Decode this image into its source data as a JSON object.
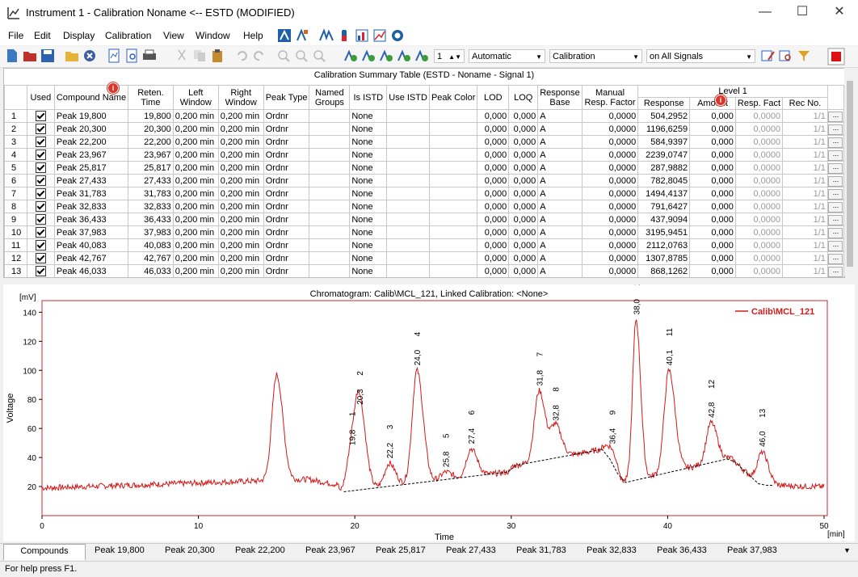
{
  "window": {
    "title": "Instrument 1 - Calibration Noname <-- ESTD (MODIFIED)"
  },
  "menu": [
    "File",
    "Edit",
    "Display",
    "Calibration",
    "View",
    "Window",
    "Help"
  ],
  "toolbar": {
    "page_value": "1",
    "combo_mode": "Automatic",
    "combo_view": "Calibration",
    "combo_signals": "on All Signals"
  },
  "table": {
    "caption": "Calibration Summary Table (ESTD - Noname - Signal 1)",
    "headers": {
      "used": "Used",
      "compound": "Compound Name",
      "reten": "Reten. Time",
      "left": "Left Window",
      "right": "Right Window",
      "peaktype": "Peak Type",
      "named": "Named Groups",
      "isistd": "Is ISTD",
      "useistd": "Use ISTD",
      "color": "Peak Color",
      "lod": "LOD",
      "loq": "LOQ",
      "base": "Response Base",
      "manual": "Manual Resp. Factor",
      "level": "Level 1",
      "response": "Response",
      "amount": "Amount",
      "respfact": "Resp. Fact",
      "recno": "Rec No."
    },
    "rows": [
      {
        "n": "1",
        "name": "Peak 19,800",
        "rt": "19,800",
        "lw": "0,200 min",
        "rw": "0,200 min",
        "pt": "Ordnr",
        "istd": "None",
        "lod": "0,000",
        "loq": "0,000",
        "base": "A",
        "mrf": "0,0000",
        "resp": "504,2952",
        "amt": "0,000",
        "rf": "0,0000",
        "rec": "1/1"
      },
      {
        "n": "2",
        "name": "Peak 20,300",
        "rt": "20,300",
        "lw": "0,200 min",
        "rw": "0,200 min",
        "pt": "Ordnr",
        "istd": "None",
        "lod": "0,000",
        "loq": "0,000",
        "base": "A",
        "mrf": "0,0000",
        "resp": "1196,6259",
        "amt": "0,000",
        "rf": "0,0000",
        "rec": "1/1"
      },
      {
        "n": "3",
        "name": "Peak 22,200",
        "rt": "22,200",
        "lw": "0,200 min",
        "rw": "0,200 min",
        "pt": "Ordnr",
        "istd": "None",
        "lod": "0,000",
        "loq": "0,000",
        "base": "A",
        "mrf": "0,0000",
        "resp": "584,9397",
        "amt": "0,000",
        "rf": "0,0000",
        "rec": "1/1"
      },
      {
        "n": "4",
        "name": "Peak 23,967",
        "rt": "23,967",
        "lw": "0,200 min",
        "rw": "0,200 min",
        "pt": "Ordnr",
        "istd": "None",
        "lod": "0,000",
        "loq": "0,000",
        "base": "A",
        "mrf": "0,0000",
        "resp": "2239,0747",
        "amt": "0,000",
        "rf": "0,0000",
        "rec": "1/1"
      },
      {
        "n": "5",
        "name": "Peak 25,817",
        "rt": "25,817",
        "lw": "0,200 min",
        "rw": "0,200 min",
        "pt": "Ordnr",
        "istd": "None",
        "lod": "0,000",
        "loq": "0,000",
        "base": "A",
        "mrf": "0,0000",
        "resp": "287,9882",
        "amt": "0,000",
        "rf": "0,0000",
        "rec": "1/1"
      },
      {
        "n": "6",
        "name": "Peak 27,433",
        "rt": "27,433",
        "lw": "0,200 min",
        "rw": "0,200 min",
        "pt": "Ordnr",
        "istd": "None",
        "lod": "0,000",
        "loq": "0,000",
        "base": "A",
        "mrf": "0,0000",
        "resp": "782,8045",
        "amt": "0,000",
        "rf": "0,0000",
        "rec": "1/1"
      },
      {
        "n": "7",
        "name": "Peak 31,783",
        "rt": "31,783",
        "lw": "0,200 min",
        "rw": "0,200 min",
        "pt": "Ordnr",
        "istd": "None",
        "lod": "0,000",
        "loq": "0,000",
        "base": "A",
        "mrf": "0,0000",
        "resp": "1494,4137",
        "amt": "0,000",
        "rf": "0,0000",
        "rec": "1/1"
      },
      {
        "n": "8",
        "name": "Peak 32,833",
        "rt": "32,833",
        "lw": "0,200 min",
        "rw": "0,200 min",
        "pt": "Ordnr",
        "istd": "None",
        "lod": "0,000",
        "loq": "0,000",
        "base": "A",
        "mrf": "0,0000",
        "resp": "791,6427",
        "amt": "0,000",
        "rf": "0,0000",
        "rec": "1/1"
      },
      {
        "n": "9",
        "name": "Peak 36,433",
        "rt": "36,433",
        "lw": "0,200 min",
        "rw": "0,200 min",
        "pt": "Ordnr",
        "istd": "None",
        "lod": "0,000",
        "loq": "0,000",
        "base": "A",
        "mrf": "0,0000",
        "resp": "437,9094",
        "amt": "0,000",
        "rf": "0,0000",
        "rec": "1/1"
      },
      {
        "n": "10",
        "name": "Peak 37,983",
        "rt": "37,983",
        "lw": "0,200 min",
        "rw": "0,200 min",
        "pt": "Ordnr",
        "istd": "None",
        "lod": "0,000",
        "loq": "0,000",
        "base": "A",
        "mrf": "0,0000",
        "resp": "3195,9451",
        "amt": "0,000",
        "rf": "0,0000",
        "rec": "1/1"
      },
      {
        "n": "11",
        "name": "Peak 40,083",
        "rt": "40,083",
        "lw": "0,200 min",
        "rw": "0,200 min",
        "pt": "Ordnr",
        "istd": "None",
        "lod": "0,000",
        "loq": "0,000",
        "base": "A",
        "mrf": "0,0000",
        "resp": "2112,0763",
        "amt": "0,000",
        "rf": "0,0000",
        "rec": "1/1"
      },
      {
        "n": "12",
        "name": "Peak 42,767",
        "rt": "42,767",
        "lw": "0,200 min",
        "rw": "0,200 min",
        "pt": "Ordnr",
        "istd": "None",
        "lod": "0,000",
        "loq": "0,000",
        "base": "A",
        "mrf": "0,0000",
        "resp": "1307,8785",
        "amt": "0,000",
        "rf": "0,0000",
        "rec": "1/1"
      },
      {
        "n": "13",
        "name": "Peak 46,033",
        "rt": "46,033",
        "lw": "0,200 min",
        "rw": "0,200 min",
        "pt": "Ordnr",
        "istd": "None",
        "lod": "0,000",
        "loq": "0,000",
        "base": "A",
        "mrf": "0,0000",
        "resp": "868,1262",
        "amt": "0,000",
        "rf": "0,0000",
        "rec": "1/1"
      }
    ],
    "ellipsis": "..."
  },
  "chart_data": {
    "type": "line",
    "title": "Chromatogram: Calib\\MCL_121, Linked Calibration: <None>",
    "xlabel": "Time",
    "xunit": "[min]",
    "ylabel": "Voltage",
    "yunit": "[mV]",
    "xlim": [
      0,
      50
    ],
    "ylim": [
      0,
      148
    ],
    "xticks": [
      0,
      10,
      20,
      30,
      40,
      50
    ],
    "yticks": [
      20,
      40,
      60,
      80,
      100,
      120,
      140
    ],
    "legend": {
      "position": "top-right",
      "label": "Calib\\MCL_121"
    },
    "series_color": "#d21a1a",
    "peaks": [
      {
        "label": "1",
        "rt_label": "19,8",
        "x": 19.8,
        "y": 45
      },
      {
        "label": "2",
        "rt_label": "20,3",
        "x": 20.3,
        "y": 73
      },
      {
        "label": "3",
        "rt_label": "22,2",
        "x": 22.2,
        "y": 36
      },
      {
        "label": "4",
        "rt_label": "24,0",
        "x": 23.97,
        "y": 100
      },
      {
        "label": "5",
        "rt_label": "25,8",
        "x": 25.8,
        "y": 30
      },
      {
        "label": "6",
        "rt_label": "27,4",
        "x": 27.43,
        "y": 46
      },
      {
        "label": "7",
        "rt_label": "31,8",
        "x": 31.78,
        "y": 86
      },
      {
        "label": "8",
        "rt_label": "32,8",
        "x": 32.83,
        "y": 62
      },
      {
        "label": "9",
        "rt_label": "36,4",
        "x": 36.43,
        "y": 46
      },
      {
        "label": "10",
        "rt_label": "38,0",
        "x": 37.98,
        "y": 135
      },
      {
        "label": "11",
        "rt_label": "40,1",
        "x": 40.08,
        "y": 100
      },
      {
        "label": "12",
        "rt_label": "42,8",
        "x": 42.77,
        "y": 64
      },
      {
        "label": "13",
        "rt_label": "46,0",
        "x": 46.03,
        "y": 44
      }
    ],
    "unlabeled_peaks": [
      {
        "x": 15.0,
        "y": 97
      }
    ]
  },
  "tabs": [
    "Compounds",
    "Peak 19,800",
    "Peak 20,300",
    "Peak 22,200",
    "Peak 23,967",
    "Peak 25,817",
    "Peak 27,433",
    "Peak 31,783",
    "Peak 32,833",
    "Peak 36,433",
    "Peak 37,983"
  ],
  "status": "For help press F1."
}
